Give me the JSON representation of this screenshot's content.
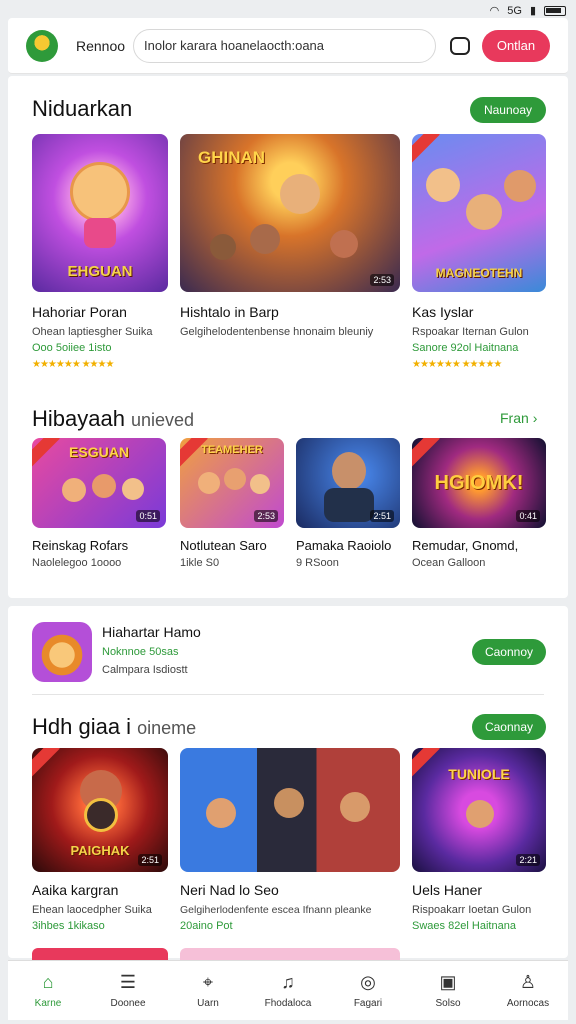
{
  "status_bar": {
    "icons": [
      "wifi-icon",
      "signal-icon",
      "battery-icon"
    ],
    "network": "5G"
  },
  "header": {
    "brand": "Rennoo",
    "search_placeholder": "Inolor karara hoanelaocth:oana",
    "signin_label": "Ontlan"
  },
  "featured": {
    "title": "Niduarkan",
    "button_label": "Naunoay",
    "items": [
      {
        "title": "Hahoriar Poran",
        "line1": "Ohean laptiesgher Suika",
        "line2": "Ooo 5oiiee 1isto",
        "tile_caption": "EHGUAN"
      },
      {
        "title": "Hishtalo in Barp",
        "line1": "Gelgihelodentenbense hnonaim bleuniy",
        "line2": "",
        "tile_caption": "GHINAN",
        "badge": "2:53"
      },
      {
        "title": "Kas Iyslar",
        "line1": "Rspoakar Iternan Gulon",
        "line2": "Sanore 92ol Haitnana",
        "tile_caption": "MAGNEOTEHN"
      }
    ]
  },
  "second": {
    "title": "Hibayaah",
    "subtitle": "unieved",
    "more_label": "Fran",
    "items": [
      {
        "title": "Reinskag Rofars",
        "line1": "Naolelegoo 1oooo",
        "tile_caption": "ESGUAN",
        "badge": "0:51"
      },
      {
        "title": "Notlutean Saro",
        "line1": "1ikle S0",
        "tile_caption": "TEAMEHER",
        "badge": "2:53"
      },
      {
        "title": "Pamaka Raoiolo",
        "line1": "9 RSoon",
        "tile_caption": "",
        "badge": "2:51"
      },
      {
        "title": "Remudar, Gnomd,",
        "line1": "Ocean Galloon",
        "tile_caption": "HGIOMK!",
        "badge": "0:41"
      }
    ]
  },
  "promo": {
    "title": "Hiahartar Hamo",
    "line1": "Noknnoe 50sas",
    "line2": "Calmpara Isdiostt",
    "button_label": "Caonnoy"
  },
  "third": {
    "title": "Hdh giaa i",
    "subtitle": "oineme",
    "button_label": "Caonnay",
    "items": [
      {
        "title": "Aaika kargran",
        "line1": "Ehean laocedpher Suika",
        "line2": "3ihbes 1kikaso",
        "tile_caption": "PAIGHAK",
        "badge": "2:51"
      },
      {
        "title": "Neri Nad lo Seo",
        "line1": "Gelgiherlodenfente escea Ifnann pleanke",
        "line2": "20aino Pot",
        "tile_caption": "",
        "badge": ""
      },
      {
        "title": "Uels Haner",
        "line1": "Rispoakarr Ioetan Gulon",
        "line2": "Swaes 82el Haitnana",
        "tile_caption": "TUNIOLE",
        "badge": "2:21"
      }
    ]
  },
  "bottom_nav": [
    {
      "label": "Karne",
      "icon": "home-icon",
      "glyph": "⌂"
    },
    {
      "label": "Doonee",
      "icon": "list-icon",
      "glyph": "☰"
    },
    {
      "label": "Uarn",
      "icon": "pin-icon",
      "glyph": "⌖"
    },
    {
      "label": "Fhodaloca",
      "icon": "bell-icon",
      "glyph": "♫"
    },
    {
      "label": "Fagari",
      "icon": "app-icon",
      "glyph": "◎"
    },
    {
      "label": "Solso",
      "icon": "gallery-icon",
      "glyph": "▣"
    },
    {
      "label": "Aornocas",
      "icon": "user-icon",
      "glyph": "♙"
    }
  ],
  "colors": {
    "accent": "#2e9a3a",
    "signin": "#e8395c",
    "stars": "#f2b000"
  }
}
